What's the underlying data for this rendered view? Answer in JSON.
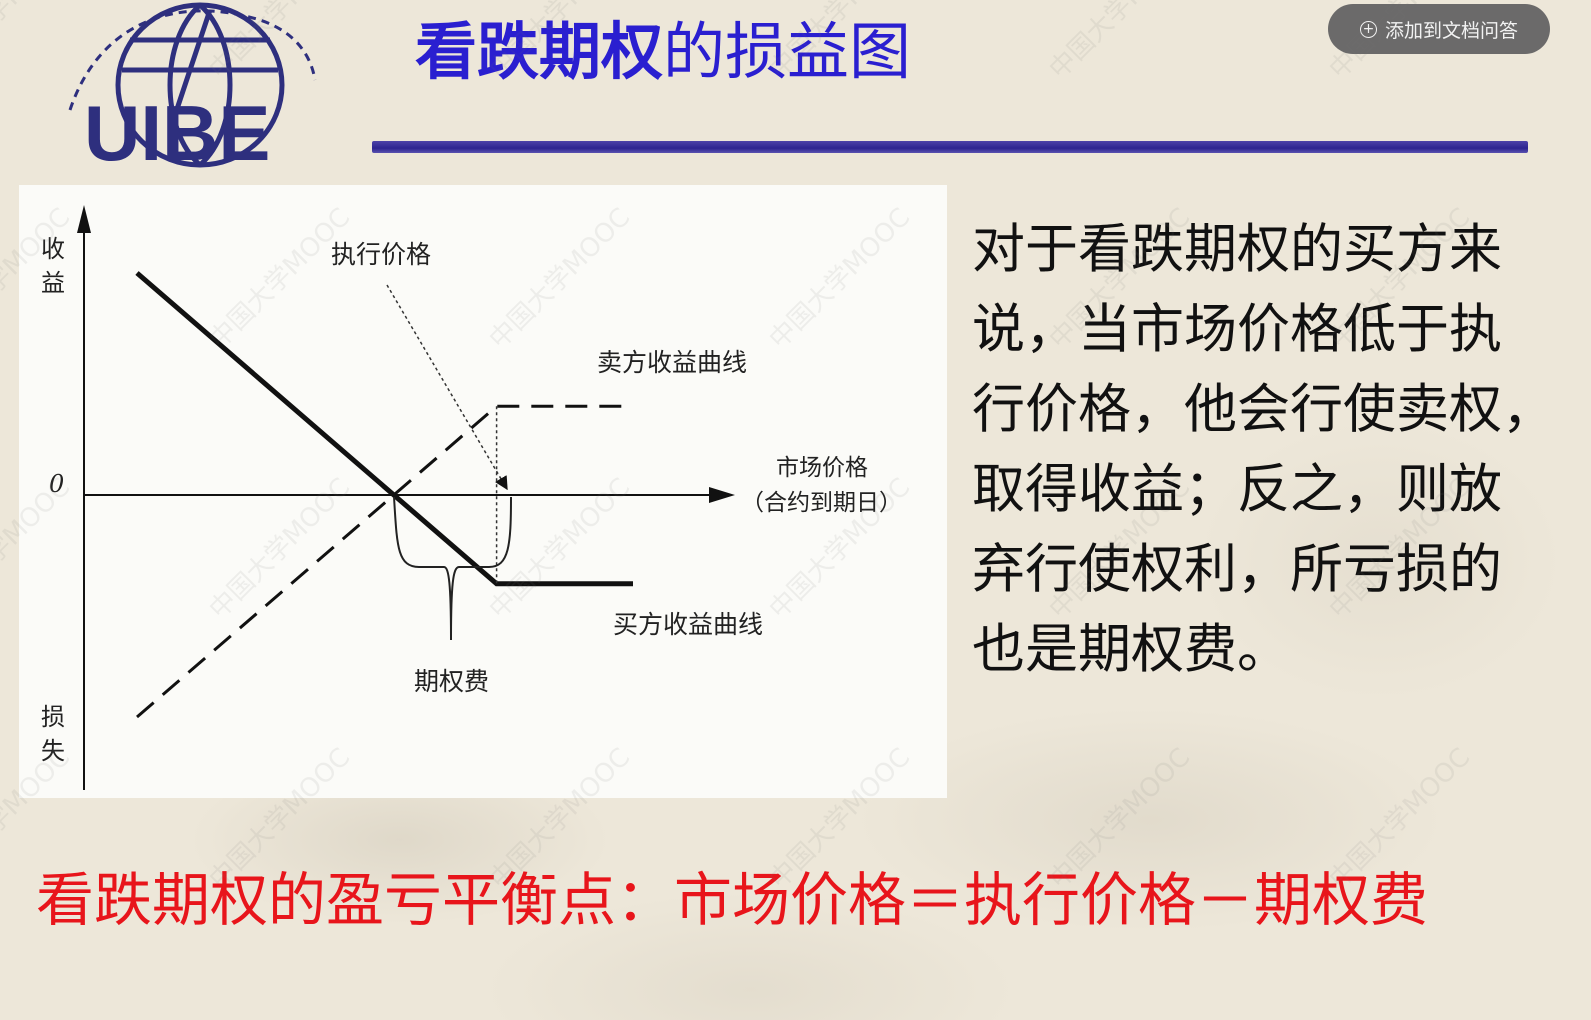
{
  "header": {
    "title_bold": "看跌期权",
    "title_rest": "的损益图"
  },
  "toolbar": {
    "add_to_qa_label": "添加到文档问答"
  },
  "logo": {
    "text": "UIBE",
    "description": "University crest with globe and arched lettering"
  },
  "chart_data": {
    "type": "line",
    "y_axis_labels": {
      "top": "收益",
      "bottom": "损失"
    },
    "origin_label": "0",
    "x_axis_label": [
      "市场价格",
      "（合约到期日）"
    ],
    "annotations": {
      "strike": "执行价格",
      "premium": "期权费"
    },
    "series": [
      {
        "name": "买方收益曲线",
        "style": "solid",
        "x": [
          0.0,
          0.58,
          0.8
        ],
        "y": [
          1.0,
          -0.4,
          -0.4
        ]
      },
      {
        "name": "卖方收益曲线",
        "style": "dashed",
        "x": [
          0.0,
          0.58,
          0.8
        ],
        "y": [
          -1.0,
          0.4,
          0.4
        ]
      }
    ],
    "breakeven_x": 0.44,
    "strike_x": 0.58,
    "colors": {
      "buyer": "#111111",
      "seller": "#111111"
    }
  },
  "watermark": {
    "text": "中国大学MOOC"
  },
  "body": {
    "lines": [
      " 对于看跌期权的买方来",
      "说，当市场价格低于执",
      "行价格，他会行使卖权，",
      "取得收益；反之，则放",
      "弃行使权利，所亏损的",
      "也是期权费。"
    ]
  },
  "footer": {
    "formula": "看跌期权的盈亏平衡点：市场价格＝执行价格－期权费"
  },
  "colors": {
    "title": "#2a1fd0",
    "rule": "#2d2490",
    "formula": "#e8151b",
    "background": "#ede7d9"
  }
}
